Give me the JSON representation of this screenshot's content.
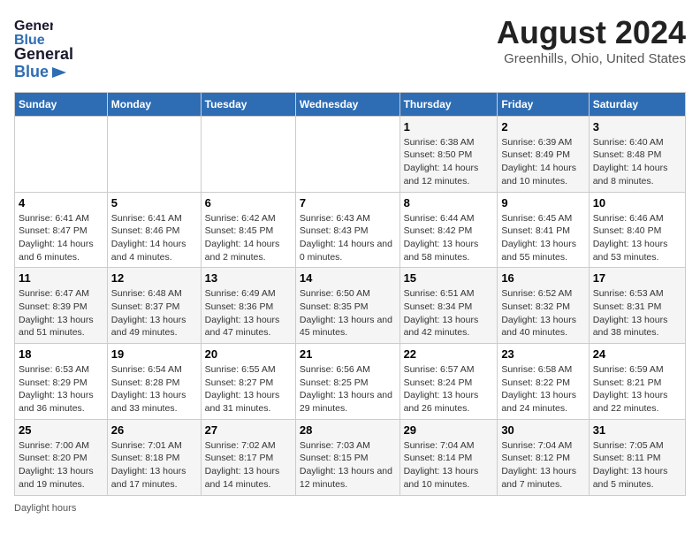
{
  "header": {
    "logo_general": "General",
    "logo_blue": "Blue",
    "title": "August 2024",
    "subtitle": "Greenhills, Ohio, United States"
  },
  "weekdays": [
    "Sunday",
    "Monday",
    "Tuesday",
    "Wednesday",
    "Thursday",
    "Friday",
    "Saturday"
  ],
  "weeks": [
    [
      {
        "day": "",
        "info": ""
      },
      {
        "day": "",
        "info": ""
      },
      {
        "day": "",
        "info": ""
      },
      {
        "day": "",
        "info": ""
      },
      {
        "day": "1",
        "info": "Sunrise: 6:38 AM\nSunset: 8:50 PM\nDaylight: 14 hours and 12 minutes."
      },
      {
        "day": "2",
        "info": "Sunrise: 6:39 AM\nSunset: 8:49 PM\nDaylight: 14 hours and 10 minutes."
      },
      {
        "day": "3",
        "info": "Sunrise: 6:40 AM\nSunset: 8:48 PM\nDaylight: 14 hours and 8 minutes."
      }
    ],
    [
      {
        "day": "4",
        "info": "Sunrise: 6:41 AM\nSunset: 8:47 PM\nDaylight: 14 hours and 6 minutes."
      },
      {
        "day": "5",
        "info": "Sunrise: 6:41 AM\nSunset: 8:46 PM\nDaylight: 14 hours and 4 minutes."
      },
      {
        "day": "6",
        "info": "Sunrise: 6:42 AM\nSunset: 8:45 PM\nDaylight: 14 hours and 2 minutes."
      },
      {
        "day": "7",
        "info": "Sunrise: 6:43 AM\nSunset: 8:43 PM\nDaylight: 14 hours and 0 minutes."
      },
      {
        "day": "8",
        "info": "Sunrise: 6:44 AM\nSunset: 8:42 PM\nDaylight: 13 hours and 58 minutes."
      },
      {
        "day": "9",
        "info": "Sunrise: 6:45 AM\nSunset: 8:41 PM\nDaylight: 13 hours and 55 minutes."
      },
      {
        "day": "10",
        "info": "Sunrise: 6:46 AM\nSunset: 8:40 PM\nDaylight: 13 hours and 53 minutes."
      }
    ],
    [
      {
        "day": "11",
        "info": "Sunrise: 6:47 AM\nSunset: 8:39 PM\nDaylight: 13 hours and 51 minutes."
      },
      {
        "day": "12",
        "info": "Sunrise: 6:48 AM\nSunset: 8:37 PM\nDaylight: 13 hours and 49 minutes."
      },
      {
        "day": "13",
        "info": "Sunrise: 6:49 AM\nSunset: 8:36 PM\nDaylight: 13 hours and 47 minutes."
      },
      {
        "day": "14",
        "info": "Sunrise: 6:50 AM\nSunset: 8:35 PM\nDaylight: 13 hours and 45 minutes."
      },
      {
        "day": "15",
        "info": "Sunrise: 6:51 AM\nSunset: 8:34 PM\nDaylight: 13 hours and 42 minutes."
      },
      {
        "day": "16",
        "info": "Sunrise: 6:52 AM\nSunset: 8:32 PM\nDaylight: 13 hours and 40 minutes."
      },
      {
        "day": "17",
        "info": "Sunrise: 6:53 AM\nSunset: 8:31 PM\nDaylight: 13 hours and 38 minutes."
      }
    ],
    [
      {
        "day": "18",
        "info": "Sunrise: 6:53 AM\nSunset: 8:29 PM\nDaylight: 13 hours and 36 minutes."
      },
      {
        "day": "19",
        "info": "Sunrise: 6:54 AM\nSunset: 8:28 PM\nDaylight: 13 hours and 33 minutes."
      },
      {
        "day": "20",
        "info": "Sunrise: 6:55 AM\nSunset: 8:27 PM\nDaylight: 13 hours and 31 minutes."
      },
      {
        "day": "21",
        "info": "Sunrise: 6:56 AM\nSunset: 8:25 PM\nDaylight: 13 hours and 29 minutes."
      },
      {
        "day": "22",
        "info": "Sunrise: 6:57 AM\nSunset: 8:24 PM\nDaylight: 13 hours and 26 minutes."
      },
      {
        "day": "23",
        "info": "Sunrise: 6:58 AM\nSunset: 8:22 PM\nDaylight: 13 hours and 24 minutes."
      },
      {
        "day": "24",
        "info": "Sunrise: 6:59 AM\nSunset: 8:21 PM\nDaylight: 13 hours and 22 minutes."
      }
    ],
    [
      {
        "day": "25",
        "info": "Sunrise: 7:00 AM\nSunset: 8:20 PM\nDaylight: 13 hours and 19 minutes."
      },
      {
        "day": "26",
        "info": "Sunrise: 7:01 AM\nSunset: 8:18 PM\nDaylight: 13 hours and 17 minutes."
      },
      {
        "day": "27",
        "info": "Sunrise: 7:02 AM\nSunset: 8:17 PM\nDaylight: 13 hours and 14 minutes."
      },
      {
        "day": "28",
        "info": "Sunrise: 7:03 AM\nSunset: 8:15 PM\nDaylight: 13 hours and 12 minutes."
      },
      {
        "day": "29",
        "info": "Sunrise: 7:04 AM\nSunset: 8:14 PM\nDaylight: 13 hours and 10 minutes."
      },
      {
        "day": "30",
        "info": "Sunrise: 7:04 AM\nSunset: 8:12 PM\nDaylight: 13 hours and 7 minutes."
      },
      {
        "day": "31",
        "info": "Sunrise: 7:05 AM\nSunset: 8:11 PM\nDaylight: 13 hours and 5 minutes."
      }
    ]
  ],
  "footer": {
    "daylight_label": "Daylight hours"
  }
}
